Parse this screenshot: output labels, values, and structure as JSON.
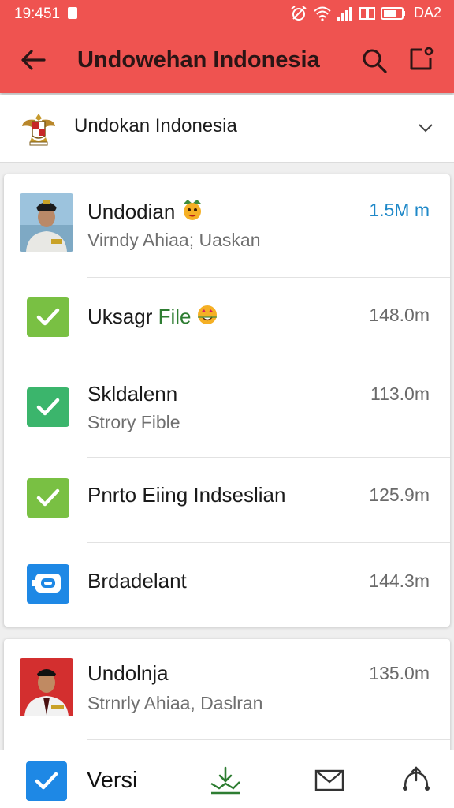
{
  "status_bar": {
    "time": "19:451",
    "battery_text": "DA2"
  },
  "app_bar": {
    "title": "Undowehan Indonesia",
    "icons": [
      "back-arrow-icon",
      "search-icon",
      "compose-icon"
    ]
  },
  "selector": {
    "label": "Undokan Indonesia",
    "icon": "garuda-emblem-icon"
  },
  "list": [
    {
      "title": "Undodian",
      "subtitle": "Virndy Ahiaa; Uaskan",
      "size": "1.5M m",
      "icon": "avatar-officer",
      "size_color": "#1e88c8"
    },
    {
      "title_prefix": "Uksagr ",
      "title_highlight": "File",
      "size": "148.0m",
      "icon": "check-icon",
      "highlight_color": "#2e7d32"
    },
    {
      "title": "Skldalenn",
      "subtitle": "Strory Fible",
      "size": "113.0m",
      "icon": "check-icon"
    },
    {
      "title": "Pnrto Eiing Indseslian",
      "size": "125.9m",
      "icon": "check-icon"
    },
    {
      "title": "Brdadelant",
      "size": "144.3m",
      "icon": "app-box-icon"
    }
  ],
  "list2": [
    {
      "title": "Undolnja",
      "subtitle": "Strnrly Ahiaa, Daslran",
      "size": "135.0m",
      "icon": "avatar-uniform"
    }
  ],
  "bottom_bar": {
    "label": "Versi",
    "icons": [
      "check-icon",
      "download-icon",
      "mail-icon",
      "share-icon"
    ]
  },
  "colors": {
    "app_bar": "#ef5350",
    "accent_blue": "#1e88e5",
    "check_green": "#79c043",
    "check_teal": "#3bb56c"
  }
}
